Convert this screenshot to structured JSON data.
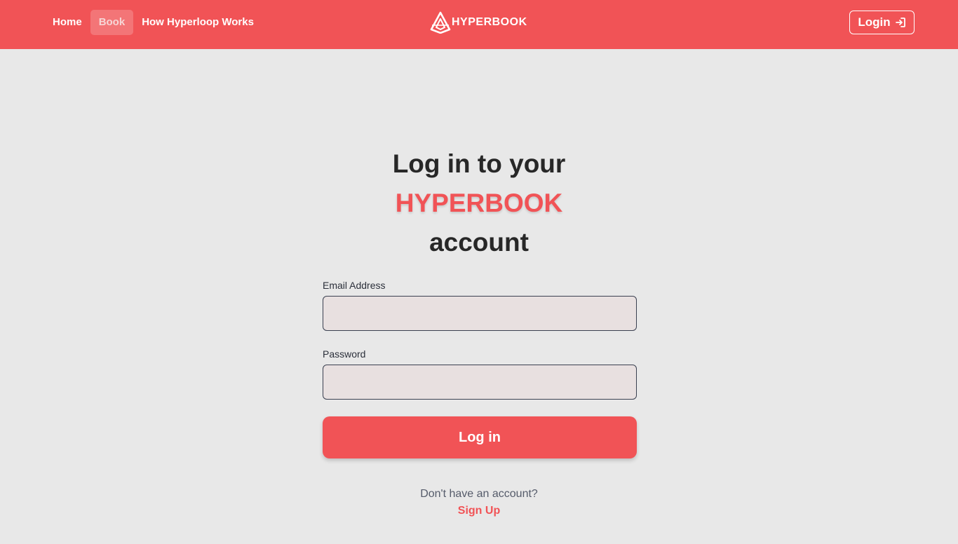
{
  "nav": {
    "links": [
      "Home",
      "Book",
      "How Hyperloop Works"
    ],
    "active_index": 1,
    "brand": "HYPERBOOK",
    "brand_icon": "hyperbook-logo-icon",
    "login_label": "Login",
    "login_icon": "sign-in-icon"
  },
  "heading": {
    "line1": "Log in to your",
    "brand": "HYPERBOOK",
    "line3": "account"
  },
  "form": {
    "email_label": "Email Address",
    "email_value": "",
    "password_label": "Password",
    "password_value": "",
    "submit_label": "Log in"
  },
  "footer": {
    "prompt": "Don't have an account?",
    "signup_label": "Sign Up"
  },
  "colors": {
    "accent": "#f15356",
    "background": "#e8e8e8",
    "input_fill": "#e8e0e0"
  }
}
